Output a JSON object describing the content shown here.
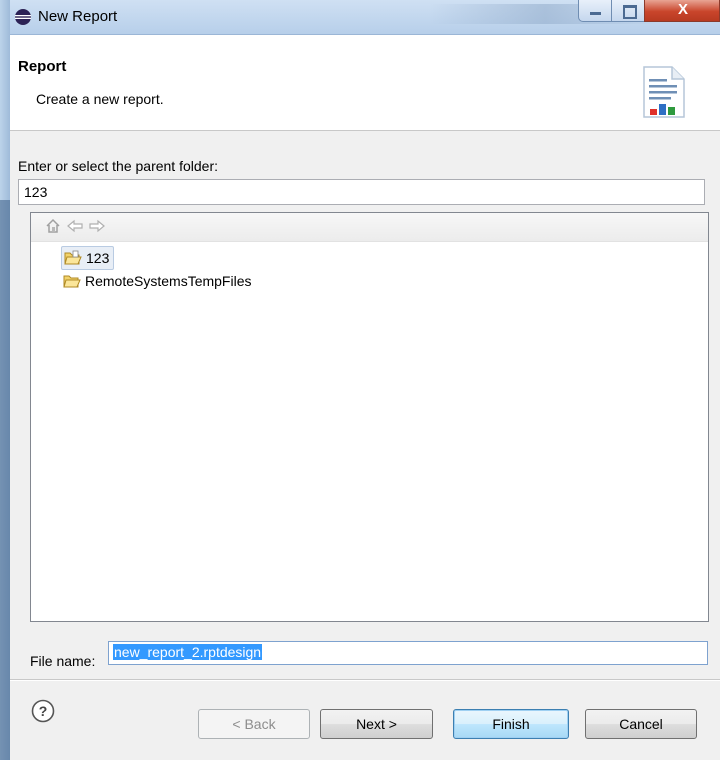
{
  "window": {
    "title": "New Report",
    "buttons": {
      "minimize_icon": "minimize-icon",
      "maximize_icon": "maximize-icon",
      "close_label": "X"
    }
  },
  "header": {
    "title": "Report",
    "description": "Create a new report.",
    "icon": "report-icon"
  },
  "parent_folder": {
    "label": "Enter or select the parent folder:",
    "value": "123"
  },
  "tree": {
    "toolbar_icons": [
      "home-icon",
      "back-arrow-icon",
      "forward-arrow-icon"
    ],
    "items": [
      {
        "label": "123",
        "icon": "open-folder-icon",
        "selected": true
      },
      {
        "label": "RemoteSystemsTempFiles",
        "icon": "open-folder-icon",
        "selected": false
      }
    ]
  },
  "file_name": {
    "label": "File name:",
    "value": "new_report_2.rptdesign"
  },
  "buttons": {
    "help_icon": "help-icon",
    "back": "< Back",
    "next": "Next >",
    "finish": "Finish",
    "cancel": "Cancel"
  }
}
